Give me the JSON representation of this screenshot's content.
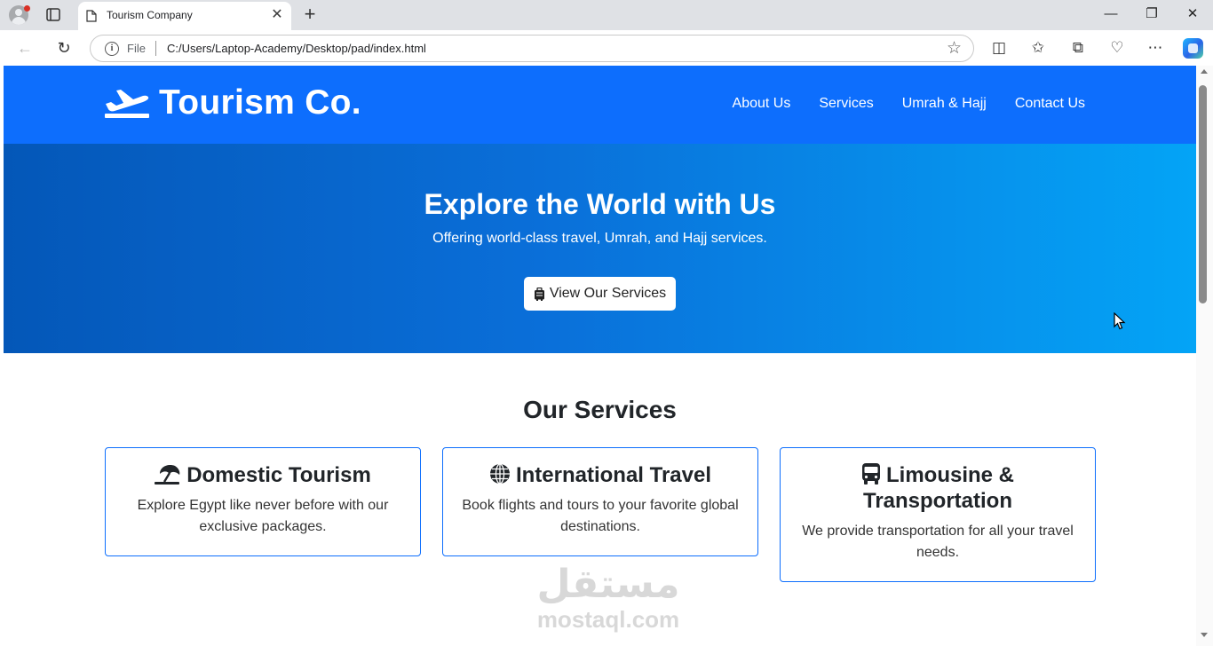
{
  "browser": {
    "tab_title": "Tourism Company",
    "tab_close": "✕",
    "new_tab": "+",
    "window_controls": {
      "minimize": "—",
      "restore": "❐",
      "close": "✕"
    },
    "address_label": "File",
    "url": "C:/Users/Laptop-Academy/Desktop/pad/index.html",
    "icons": [
      "back-icon",
      "reload-icon",
      "info-icon",
      "favorite-star-icon",
      "split-screen-icon",
      "favorites-icon",
      "collections-icon",
      "performance-icon",
      "more-icon",
      "copilot-icon"
    ]
  },
  "site": {
    "brand": "Tourism Co.",
    "nav": [
      {
        "label": "About Us"
      },
      {
        "label": "Services"
      },
      {
        "label": "Umrah & Hajj"
      },
      {
        "label": "Contact Us"
      }
    ],
    "hero": {
      "title": "Explore the World with Us",
      "subtitle": "Offering world-class travel, Umrah, and Hajj services.",
      "button": "View Our Services"
    },
    "services_title": "Our Services",
    "services": [
      {
        "title": "Domestic Tourism",
        "icon": "beach-umbrella-icon",
        "text": "Explore Egypt like never before with our exclusive packages."
      },
      {
        "title": "International Travel",
        "icon": "globe-icon",
        "text": "Book flights and tours to your favorite global destinations."
      },
      {
        "title": "Limousine & Transportation",
        "icon": "bus-icon",
        "text": "We provide transportation for all your travel needs."
      }
    ],
    "colors": {
      "primary": "#0d6efd",
      "hero_start": "#0457b8",
      "hero_end": "#04a4f6"
    }
  },
  "watermark": {
    "arabic": "مستقل",
    "latin": "mostaql.com"
  }
}
